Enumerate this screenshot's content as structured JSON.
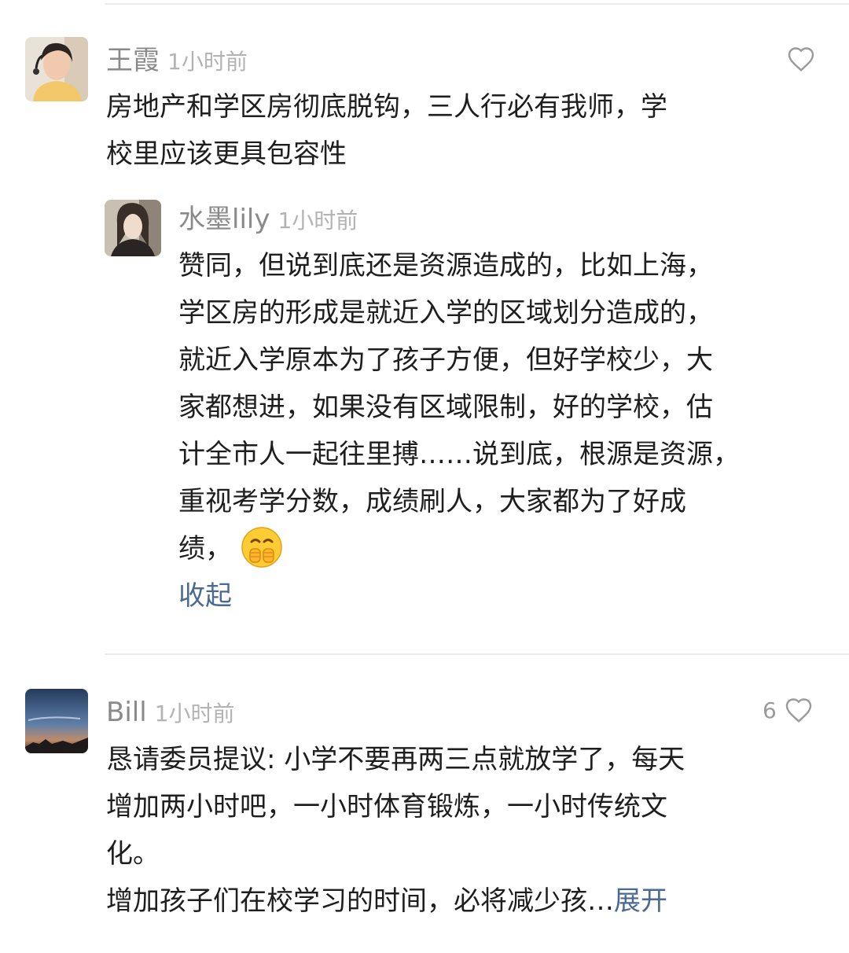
{
  "comments": [
    {
      "user": "王霞",
      "time": "1小时前",
      "lines": [
        "房地产和学区房彻底脱钩，三人行必有我师，学",
        "校里应该更具包容性"
      ],
      "reply": {
        "user": "水墨lily",
        "time": "1小时前",
        "lines": [
          "赞同，但说到底还是资源造成的，比如上海，",
          "学区房的形成是就近入学的区域划分造成的，",
          "就近入学原本为了孩子方便，但好学校少，大",
          "家都想进，如果没有区域限制，好的学校，估",
          "计全市人一起往里搏……说到底，根源是资源，",
          "重视考学分数，成绩刷人，大家都为了好成",
          "绩，"
        ],
        "collapse_label": "收起"
      }
    },
    {
      "user": "Bill",
      "time": "1小时前",
      "like_count": "6",
      "lines": [
        "恳请委员提议: 小学不要再两三点就放学了，每天",
        "增加两小时吧，一小时体育锻炼，一小时传统文",
        "化。",
        "增加孩子们在校学习的时间，必将减少孩…"
      ],
      "expand_label": "展开"
    }
  ],
  "colors": {
    "name": "#8a8a8a",
    "time": "#b3b3b3",
    "body": "#1e1e1e",
    "link": "#4a6a91",
    "divider": "#ececec"
  },
  "icons": {
    "like": "heart-outline-icon",
    "emoji": "holding-fists-emoji"
  }
}
